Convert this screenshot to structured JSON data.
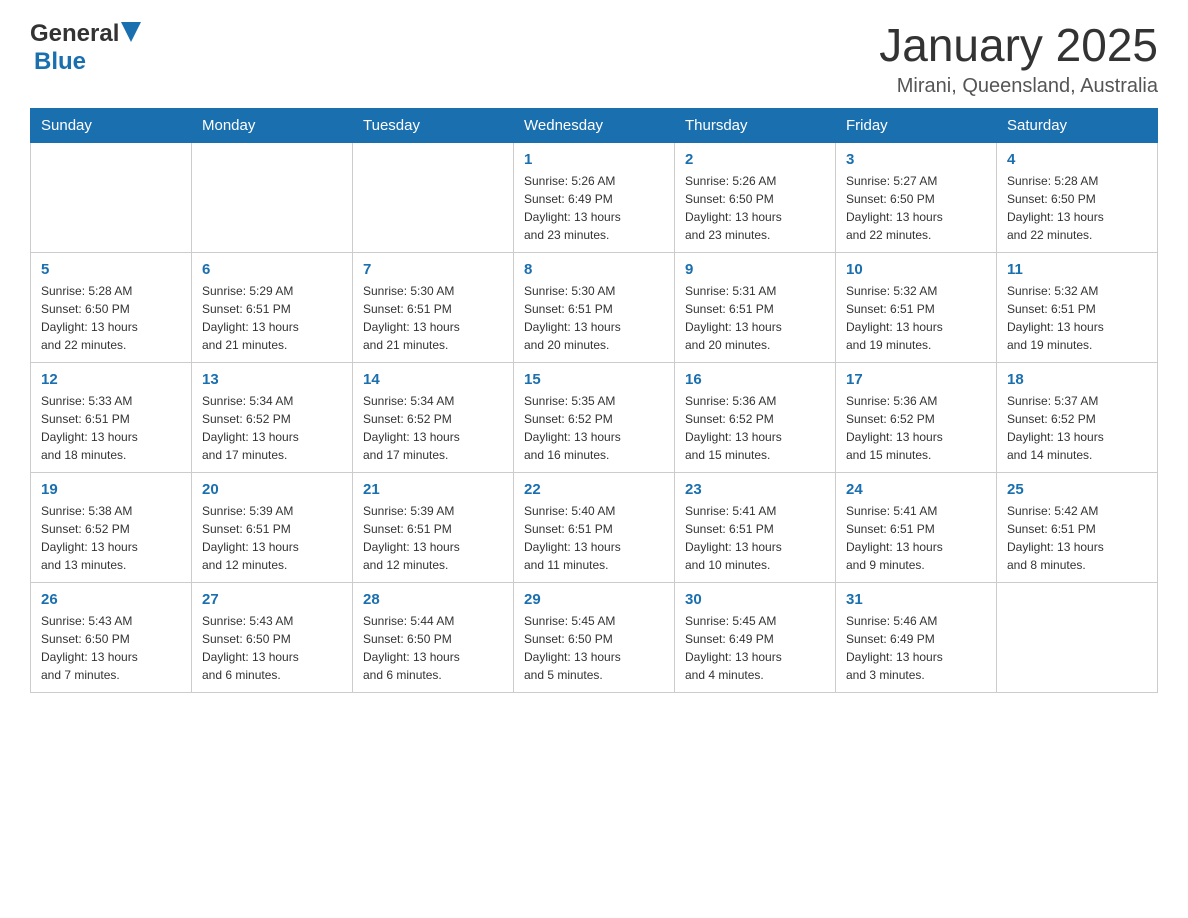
{
  "header": {
    "logo_general": "General",
    "logo_blue": "Blue",
    "month_title": "January 2025",
    "location": "Mirani, Queensland, Australia"
  },
  "days_of_week": [
    "Sunday",
    "Monday",
    "Tuesday",
    "Wednesday",
    "Thursday",
    "Friday",
    "Saturday"
  ],
  "weeks": [
    [
      {
        "day": "",
        "info": ""
      },
      {
        "day": "",
        "info": ""
      },
      {
        "day": "",
        "info": ""
      },
      {
        "day": "1",
        "info": "Sunrise: 5:26 AM\nSunset: 6:49 PM\nDaylight: 13 hours\nand 23 minutes."
      },
      {
        "day": "2",
        "info": "Sunrise: 5:26 AM\nSunset: 6:50 PM\nDaylight: 13 hours\nand 23 minutes."
      },
      {
        "day": "3",
        "info": "Sunrise: 5:27 AM\nSunset: 6:50 PM\nDaylight: 13 hours\nand 22 minutes."
      },
      {
        "day": "4",
        "info": "Sunrise: 5:28 AM\nSunset: 6:50 PM\nDaylight: 13 hours\nand 22 minutes."
      }
    ],
    [
      {
        "day": "5",
        "info": "Sunrise: 5:28 AM\nSunset: 6:50 PM\nDaylight: 13 hours\nand 22 minutes."
      },
      {
        "day": "6",
        "info": "Sunrise: 5:29 AM\nSunset: 6:51 PM\nDaylight: 13 hours\nand 21 minutes."
      },
      {
        "day": "7",
        "info": "Sunrise: 5:30 AM\nSunset: 6:51 PM\nDaylight: 13 hours\nand 21 minutes."
      },
      {
        "day": "8",
        "info": "Sunrise: 5:30 AM\nSunset: 6:51 PM\nDaylight: 13 hours\nand 20 minutes."
      },
      {
        "day": "9",
        "info": "Sunrise: 5:31 AM\nSunset: 6:51 PM\nDaylight: 13 hours\nand 20 minutes."
      },
      {
        "day": "10",
        "info": "Sunrise: 5:32 AM\nSunset: 6:51 PM\nDaylight: 13 hours\nand 19 minutes."
      },
      {
        "day": "11",
        "info": "Sunrise: 5:32 AM\nSunset: 6:51 PM\nDaylight: 13 hours\nand 19 minutes."
      }
    ],
    [
      {
        "day": "12",
        "info": "Sunrise: 5:33 AM\nSunset: 6:51 PM\nDaylight: 13 hours\nand 18 minutes."
      },
      {
        "day": "13",
        "info": "Sunrise: 5:34 AM\nSunset: 6:52 PM\nDaylight: 13 hours\nand 17 minutes."
      },
      {
        "day": "14",
        "info": "Sunrise: 5:34 AM\nSunset: 6:52 PM\nDaylight: 13 hours\nand 17 minutes."
      },
      {
        "day": "15",
        "info": "Sunrise: 5:35 AM\nSunset: 6:52 PM\nDaylight: 13 hours\nand 16 minutes."
      },
      {
        "day": "16",
        "info": "Sunrise: 5:36 AM\nSunset: 6:52 PM\nDaylight: 13 hours\nand 15 minutes."
      },
      {
        "day": "17",
        "info": "Sunrise: 5:36 AM\nSunset: 6:52 PM\nDaylight: 13 hours\nand 15 minutes."
      },
      {
        "day": "18",
        "info": "Sunrise: 5:37 AM\nSunset: 6:52 PM\nDaylight: 13 hours\nand 14 minutes."
      }
    ],
    [
      {
        "day": "19",
        "info": "Sunrise: 5:38 AM\nSunset: 6:52 PM\nDaylight: 13 hours\nand 13 minutes."
      },
      {
        "day": "20",
        "info": "Sunrise: 5:39 AM\nSunset: 6:51 PM\nDaylight: 13 hours\nand 12 minutes."
      },
      {
        "day": "21",
        "info": "Sunrise: 5:39 AM\nSunset: 6:51 PM\nDaylight: 13 hours\nand 12 minutes."
      },
      {
        "day": "22",
        "info": "Sunrise: 5:40 AM\nSunset: 6:51 PM\nDaylight: 13 hours\nand 11 minutes."
      },
      {
        "day": "23",
        "info": "Sunrise: 5:41 AM\nSunset: 6:51 PM\nDaylight: 13 hours\nand 10 minutes."
      },
      {
        "day": "24",
        "info": "Sunrise: 5:41 AM\nSunset: 6:51 PM\nDaylight: 13 hours\nand 9 minutes."
      },
      {
        "day": "25",
        "info": "Sunrise: 5:42 AM\nSunset: 6:51 PM\nDaylight: 13 hours\nand 8 minutes."
      }
    ],
    [
      {
        "day": "26",
        "info": "Sunrise: 5:43 AM\nSunset: 6:50 PM\nDaylight: 13 hours\nand 7 minutes."
      },
      {
        "day": "27",
        "info": "Sunrise: 5:43 AM\nSunset: 6:50 PM\nDaylight: 13 hours\nand 6 minutes."
      },
      {
        "day": "28",
        "info": "Sunrise: 5:44 AM\nSunset: 6:50 PM\nDaylight: 13 hours\nand 6 minutes."
      },
      {
        "day": "29",
        "info": "Sunrise: 5:45 AM\nSunset: 6:50 PM\nDaylight: 13 hours\nand 5 minutes."
      },
      {
        "day": "30",
        "info": "Sunrise: 5:45 AM\nSunset: 6:49 PM\nDaylight: 13 hours\nand 4 minutes."
      },
      {
        "day": "31",
        "info": "Sunrise: 5:46 AM\nSunset: 6:49 PM\nDaylight: 13 hours\nand 3 minutes."
      },
      {
        "day": "",
        "info": ""
      }
    ]
  ]
}
